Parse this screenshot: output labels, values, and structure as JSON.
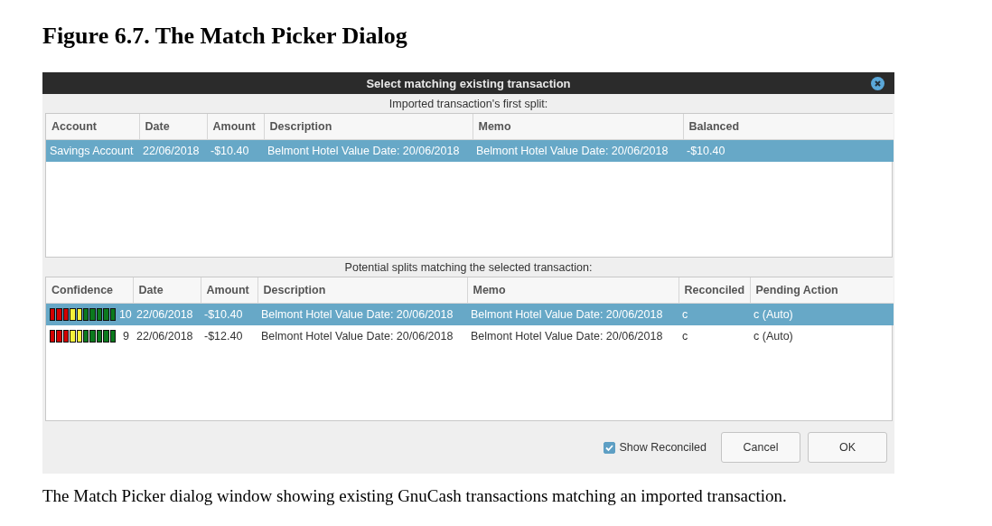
{
  "heading": "Figure 6.7. The Match Picker Dialog",
  "dialog": {
    "title": "Select matching existing transaction",
    "imported": {
      "label": "Imported transaction's first split:",
      "columns": [
        "Account",
        "Date",
        "Amount",
        "Description",
        "Memo",
        "Balanced"
      ],
      "rows": [
        {
          "selected": true,
          "cells": [
            "Savings Account",
            "22/06/2018",
            "-$10.40",
            "Belmont Hotel Value Date: 20/06/2018",
            "Belmont Hotel Value Date: 20/06/2018",
            "-$10.40"
          ]
        }
      ]
    },
    "matches": {
      "label": "Potential splits matching the selected transaction:",
      "columns": [
        "Confidence",
        "Date",
        "Amount",
        "Description",
        "Memo",
        "Reconciled",
        "Pending Action"
      ],
      "rows": [
        {
          "selected": true,
          "cells": [
            "10",
            "22/06/2018",
            "-$10.40",
            "Belmont Hotel Value Date: 20/06/2018",
            "Belmont Hotel Value Date: 20/06/2018",
            "c",
            "c (Auto)"
          ]
        },
        {
          "selected": false,
          "cells": [
            "9",
            "22/06/2018",
            "-$12.40",
            "Belmont Hotel Value Date: 20/06/2018",
            "Belmont Hotel Value Date: 20/06/2018",
            "c",
            "c (Auto)"
          ]
        }
      ]
    },
    "show_reconciled": {
      "label": "Show Reconciled",
      "checked": true
    },
    "buttons": [
      "Cancel",
      "OK"
    ]
  },
  "caption": "The Match Picker dialog window showing existing GnuCash transactions matching an imported transaction."
}
